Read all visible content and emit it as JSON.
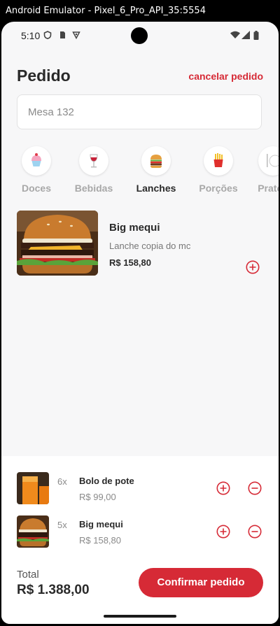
{
  "window": {
    "title": "Android Emulator - Pixel_6_Pro_API_35:5554"
  },
  "status_bar": {
    "time": "5:10"
  },
  "header": {
    "title": "Pedido",
    "cancel_label": "cancelar pedido"
  },
  "table_field": {
    "value": "Mesa 132"
  },
  "categories": [
    {
      "label": "Doces",
      "icon": "cupcake-icon",
      "active": false
    },
    {
      "label": "Bebidas",
      "icon": "wine-glass-icon",
      "active": false
    },
    {
      "label": "Lanches",
      "icon": "burger-icon",
      "active": true
    },
    {
      "label": "Porções",
      "icon": "fries-icon",
      "active": false
    },
    {
      "label": "Pratos",
      "icon": "plate-icon",
      "active": false
    }
  ],
  "products": [
    {
      "name": "Big mequi",
      "description": "Lanche copia do mc",
      "price": "R$ 158,80"
    }
  ],
  "cart": {
    "items": [
      {
        "qty": "6x",
        "name": "Bolo de pote",
        "price": "R$ 99,00"
      },
      {
        "qty": "5x",
        "name": "Big mequi",
        "price": "R$ 158,80"
      }
    ],
    "total_label": "Total",
    "total_value": "R$ 1.388,00",
    "confirm_label": "Confirmar pedido"
  },
  "colors": {
    "accent": "#d62a36",
    "background": "#f7f7f8",
    "text": "#2a2a2a"
  }
}
